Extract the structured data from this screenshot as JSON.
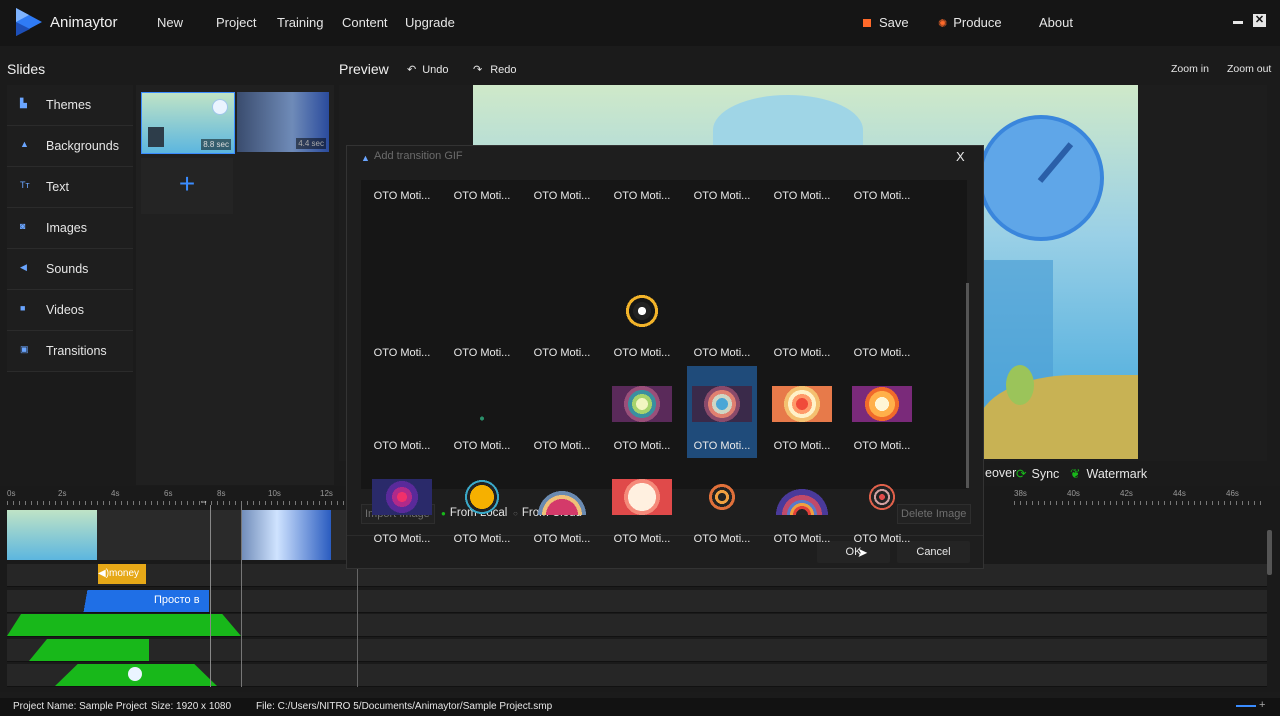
{
  "app": {
    "name": "Animaytor",
    "menu": [
      "New",
      "Project",
      "Training",
      "Content",
      "Upgrade"
    ],
    "actions": {
      "save": "Save",
      "produce": "Produce",
      "about": "About"
    }
  },
  "slides": {
    "title": "Slides",
    "nav": [
      "Themes",
      "Backgrounds",
      "Text",
      "Images",
      "Sounds",
      "Videos",
      "Transitions"
    ],
    "thumbs": [
      {
        "duration": "8.8 sec"
      },
      {
        "duration": "4.4 sec"
      }
    ],
    "add_label": "+"
  },
  "preview": {
    "title": "Preview",
    "undo": "Undo",
    "redo": "Redo",
    "zoom_in": "Zoom in",
    "zoom_out": "Zoom out",
    "bottom_tools": {
      "hover": "eover",
      "sync": "Sync",
      "watermark": "Watermark"
    }
  },
  "timeline": {
    "ticks_left": [
      "0s",
      "2s",
      "4s",
      "6s",
      "8s",
      "10s",
      "12s"
    ],
    "ticks_right": [
      "38s",
      "40s",
      "42s",
      "44s",
      "46s"
    ],
    "track_labels": {
      "money": "money",
      "text": "Просто в"
    }
  },
  "dialog": {
    "title": "Add transition GIF",
    "close": "X",
    "item_label": "OTO Moti...",
    "rows": 4,
    "cols": 7,
    "selected_index": 18,
    "import_image": "Import Image",
    "from_local": "From Local",
    "from_cloud": "From Cloud",
    "delete_image": "Delete Image",
    "ok": "OK",
    "cancel": "Cancel"
  },
  "status": {
    "project": "Project Name: Sample Project",
    "size": "Size: 1920 x 1080",
    "file": "File: C:/Users/NITRO 5/Documents/Animaytor/Sample Project.smp"
  },
  "colors": {
    "accent": "#3a8cff",
    "selection": "#1f4b7a",
    "green": "#18b81a"
  }
}
